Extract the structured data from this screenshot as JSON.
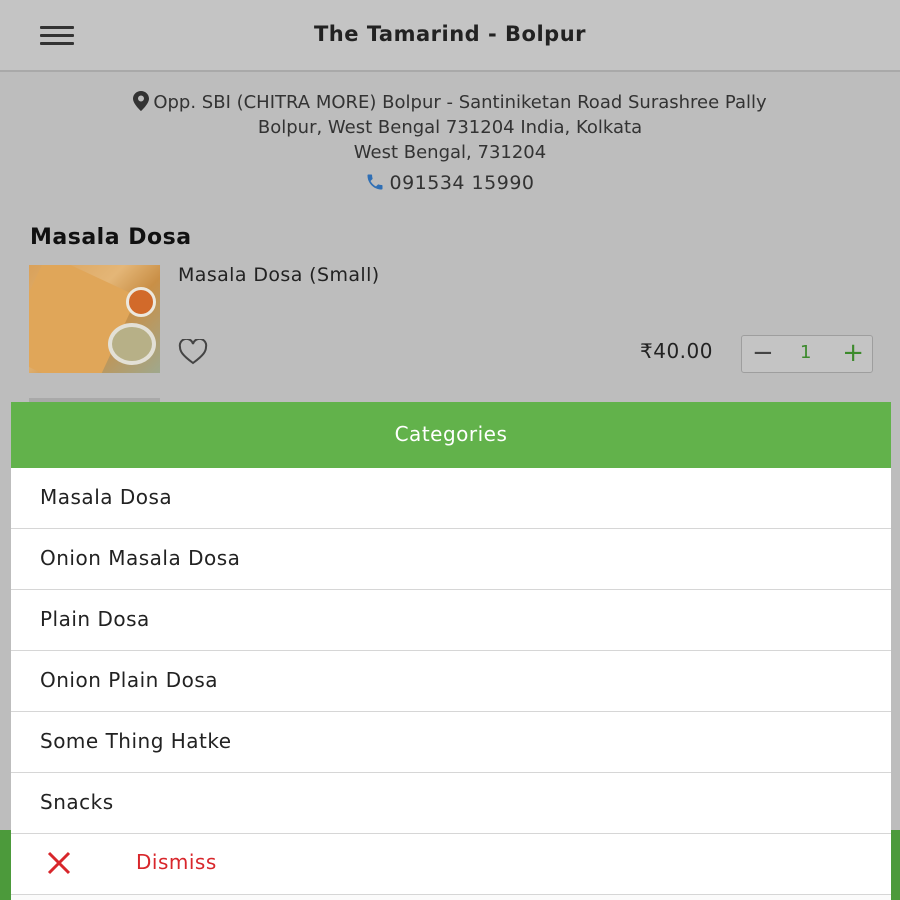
{
  "header": {
    "title": "The Tamarind - Bolpur",
    "menu_icon": "hamburger-menu-icon"
  },
  "restaurant": {
    "address_line1": "Opp. SBI (CHITRA MORE) Bolpur - Santiniketan Road Surashree Pally",
    "address_line2": "Bolpur, West Bengal 731204 India, Kolkata",
    "address_line3": "West Bengal, 731204",
    "phone": "091534 15990",
    "pin_icon": "location-pin-icon",
    "phone_icon": "phone-icon"
  },
  "menu": {
    "section_title": "Masala Dosa",
    "items": [
      {
        "name": "Masala Dosa (Small)",
        "price": "₹40.00",
        "quantity": "1",
        "minus": "−",
        "plus": "+"
      }
    ]
  },
  "categories_sheet": {
    "header": "Categories",
    "items": [
      {
        "label": "Masala Dosa"
      },
      {
        "label": "Onion Masala Dosa"
      },
      {
        "label": "Plain Dosa"
      },
      {
        "label": "Onion Plain Dosa"
      },
      {
        "label": "Some Thing Hatke"
      },
      {
        "label": "Snacks"
      }
    ],
    "dismiss_label": "Dismiss"
  },
  "colors": {
    "accent_green": "#62b24b",
    "dismiss_red": "#d8262b"
  }
}
